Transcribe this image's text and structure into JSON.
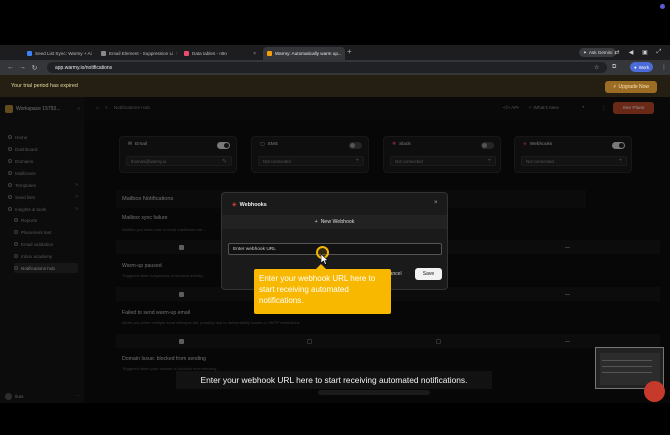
{
  "browser": {
    "tabs": [
      {
        "label": "Seed List Sync: Warmy + Ai",
        "active": false,
        "favicon_color": "#3b82f6"
      },
      {
        "label": "Email Element - Suppression Li",
        "active": false,
        "favicon_color": "#888888"
      },
      {
        "label": "Data tables - n8n",
        "active": false,
        "favicon_color": "#ea4b71"
      },
      {
        "label": "Warmy: Automatically warm up...",
        "active": true,
        "favicon_color": "#f59e0b"
      }
    ],
    "new_tab": "+",
    "ask_gemini": "Ask Gemini",
    "url": "app.warmy.io/notifications",
    "profile_label": "Work"
  },
  "banner": {
    "text": "Your trial period has expired",
    "upgrade_label": "Upgrade Now"
  },
  "sidebar": {
    "workspace": "Workspace 15793...",
    "items": [
      {
        "label": "Home"
      },
      {
        "label": "Dashboard"
      },
      {
        "label": "Domains"
      },
      {
        "label": "Mailboxes"
      },
      {
        "label": "Templates",
        "chevron": ">"
      },
      {
        "label": "Seed lists",
        "chevron": ">"
      },
      {
        "label": "Insights & tools",
        "chevron": "v"
      }
    ],
    "sub_items": [
      {
        "label": "Reports"
      },
      {
        "label": "Placement test"
      },
      {
        "label": "Email validation"
      },
      {
        "label": "Inbox academy"
      },
      {
        "label": "Notifications hub"
      }
    ],
    "user": "Ikas"
  },
  "topbar": {
    "breadcrumb_sep": ">",
    "breadcrumb_page": "Notifications Hub",
    "api_label": "API",
    "whats_new": "What's New",
    "see_plans": "See Plans"
  },
  "channels": [
    {
      "title": "Email",
      "field": "thomas@warmy.io",
      "action": "✎",
      "enabled": true
    },
    {
      "title": "SMS",
      "field": "Not connected",
      "action": "+",
      "enabled": false
    },
    {
      "title": "Slack",
      "field": "Not connected",
      "action": "+",
      "enabled": false
    },
    {
      "title": "Webhooks",
      "field": "Not connected",
      "action": "+",
      "enabled": true
    }
  ],
  "mailbox_section": {
    "title": "Mailbox Notifications",
    "notifications": [
      {
        "title": "Mailbox sync failure",
        "desc": "Notifies you when one or more mailboxes are..."
      },
      {
        "title": "Warm-up paused",
        "desc": "Triggered when suspicious or blocked activity..."
      },
      {
        "title": "Failed to send warm-up email",
        "desc": "Alerts you when multiple send attempts fail, possibly due to deliverability issues or SMTP restrictions"
      },
      {
        "title": "Domain Issue: blocked from sending",
        "desc": "Triggered when your domain is blocked from sending..."
      }
    ]
  },
  "modal": {
    "title": "Webhooks",
    "new_webhook": "New Webhook",
    "input_placeholder": "Enter webhook URL",
    "cancel": "Cancel",
    "save": "Save"
  },
  "tutorial": {
    "callout": "Enter your webhook URL here to start receiving automated notifications.",
    "caption": "Enter your webhook URL here to start receiving automated notifications."
  }
}
